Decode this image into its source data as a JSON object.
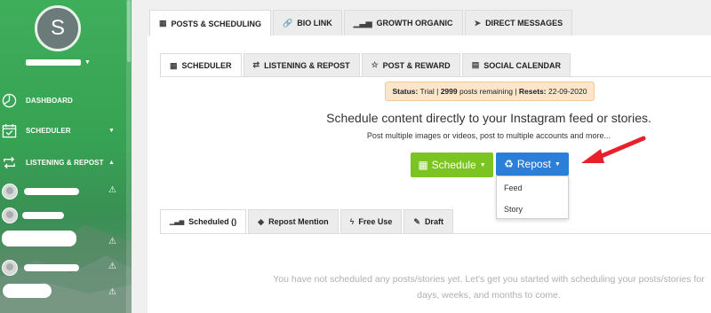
{
  "sidebar": {
    "avatar_letter": "S",
    "nav": [
      {
        "label": "DASHBOARD",
        "icon": "gauge-icon"
      },
      {
        "label": "SCHEDULER",
        "icon": "calendar-check-icon",
        "caret": "▼"
      },
      {
        "label": "LISTENING & REPOST",
        "icon": "repost-icon",
        "caret": "▲"
      }
    ],
    "warning_glyph": "⚠"
  },
  "top_tabs": [
    {
      "label": "POSTS & SCHEDULING",
      "icon": "calendar-icon"
    },
    {
      "label": "BIO LINK",
      "icon": "link-icon"
    },
    {
      "label": "GROWTH ORGANIC",
      "icon": "bar-chart-icon"
    },
    {
      "label": "DIRECT MESSAGES",
      "icon": "paper-plane-icon"
    }
  ],
  "sub_tabs": [
    {
      "label": "SCHEDULER",
      "icon": "calendar-icon"
    },
    {
      "label": "LISTENING & REPOST",
      "icon": "repost-icon"
    },
    {
      "label": "POST & REWARD",
      "icon": "star-icon"
    },
    {
      "label": "SOCIAL CALENDAR",
      "icon": "calendar-grid-icon"
    }
  ],
  "status": {
    "status_label": "Status:",
    "status_value": " Trial | ",
    "posts_count": "2999",
    "posts_text": " posts remaining | ",
    "resets_label": "Resets:",
    "resets_value": " 22-09-2020"
  },
  "main": {
    "headline": "Schedule content directly to your Instagram feed or stories.",
    "subline": "Post multiple images or videos, post to multiple accounts and more...",
    "schedule_label": "Schedule",
    "repost_label": "Repost",
    "dropdown_options": [
      "Feed",
      "Story"
    ]
  },
  "list_tabs": [
    {
      "label": "Scheduled ()",
      "icon": "bar-chart-icon"
    },
    {
      "label": "Repost Mention",
      "icon": "tag-icon"
    },
    {
      "label": "Free Use",
      "icon": "bolt-icon"
    },
    {
      "label": "Draft",
      "icon": "edit-icon"
    }
  ],
  "empty_state": {
    "line1": "You have not scheduled any posts/stories yet. Let's get you started with scheduling your posts/stories for",
    "line2": "days, weeks, and months to come."
  },
  "colors": {
    "sidebar_green": "#3fae5b",
    "schedule_green": "#7cc422",
    "repost_blue": "#2c7fd8",
    "status_bg": "#fbe6cc",
    "arrow_red": "#e8202a"
  }
}
